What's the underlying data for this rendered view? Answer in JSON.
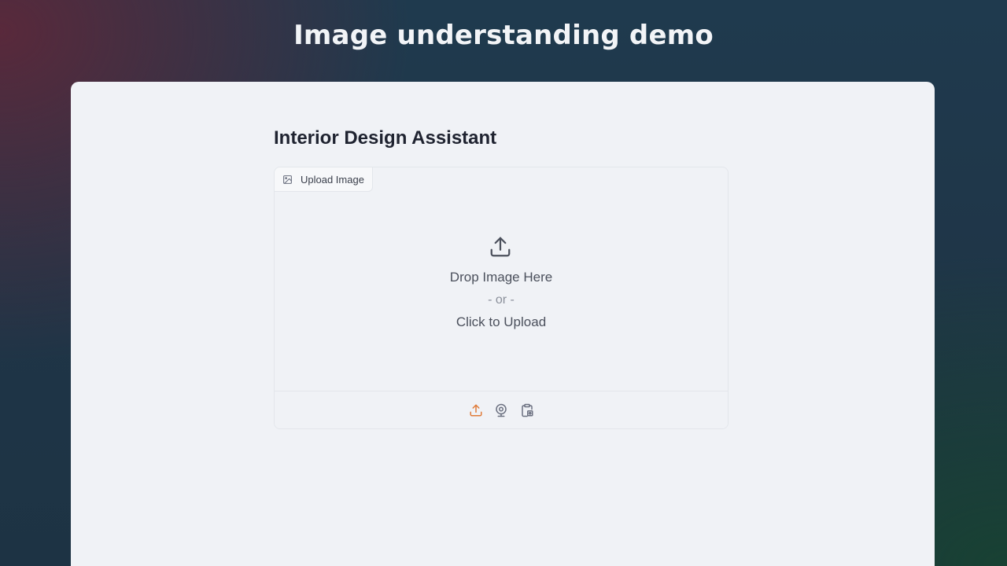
{
  "header": {
    "title": "Image understanding demo"
  },
  "main": {
    "heading": "Interior Design Assistant",
    "image_input": {
      "label": "Upload Image",
      "drop_text": "Drop Image Here",
      "or_text": "- or -",
      "click_text": "Click to Upload",
      "sources": [
        {
          "name": "upload-source-icon",
          "active": true
        },
        {
          "name": "webcam-source-icon",
          "active": false
        },
        {
          "name": "clipboard-source-icon",
          "active": false
        }
      ]
    }
  },
  "colors": {
    "accent": "#e07b39",
    "icon_gray": "#6b7080"
  }
}
